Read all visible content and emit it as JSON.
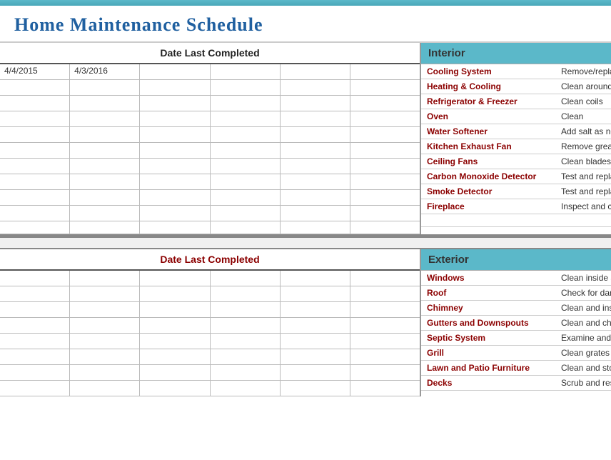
{
  "header": {
    "bar_color": "#5bb8c9",
    "title": "Home Maintenance Schedule"
  },
  "top_section": {
    "date_table": {
      "header": "Date Last Completed",
      "dates": [
        "4/4/2015",
        "4/3/2016",
        "",
        "",
        "",
        ""
      ],
      "extra_rows": 10
    },
    "interior": {
      "header": "Interior",
      "items": [
        {
          "name": "Cooling System",
          "action": "Remove/replace filters"
        },
        {
          "name": "Heating & Cooling",
          "action": "Clean around units"
        },
        {
          "name": "Refrigerator & Freezer",
          "action": "Clean coils"
        },
        {
          "name": "Oven",
          "action": "Clean"
        },
        {
          "name": "Water Softener",
          "action": "Add salt as needed"
        },
        {
          "name": "Kitchen Exhaust Fan",
          "action": "Remove grease filter"
        },
        {
          "name": "Ceiling Fans",
          "action": "Clean blades"
        },
        {
          "name": "Carbon Monoxide Detector",
          "action": "Test and replace batteries"
        },
        {
          "name": "Smoke Detector",
          "action": "Test and replace batteries"
        },
        {
          "name": "Fireplace",
          "action": "Inspect and clean"
        }
      ]
    }
  },
  "bottom_section": {
    "date_table": {
      "header": "Date Last Completed",
      "extra_rows": 10
    },
    "exterior": {
      "header": "Exterior",
      "items": [
        {
          "name": "Windows",
          "action": "Clean inside and out"
        },
        {
          "name": "Roof",
          "action": "Check for damage"
        },
        {
          "name": "Chimney",
          "action": "Clean and inspect"
        },
        {
          "name": "Gutters and Downspouts",
          "action": "Clean and check"
        },
        {
          "name": "Septic System",
          "action": "Examine and pump"
        },
        {
          "name": "Grill",
          "action": "Clean grates"
        },
        {
          "name": "Lawn and Patio Furniture",
          "action": "Clean and store"
        },
        {
          "name": "Decks",
          "action": "Scrub and reseal"
        }
      ]
    }
  }
}
